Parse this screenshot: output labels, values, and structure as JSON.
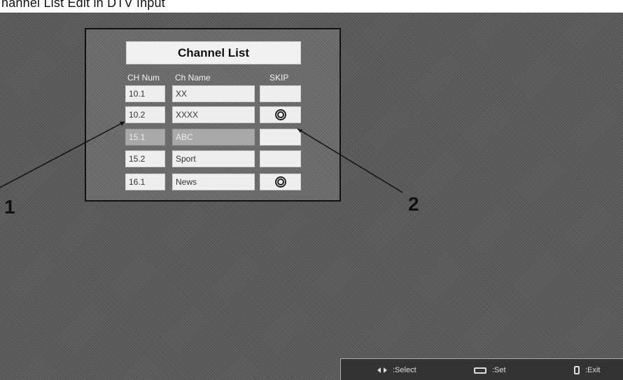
{
  "header": {
    "text": "hannel List Edit in DTV Input"
  },
  "channel_list": {
    "title": "Channel List",
    "columns": {
      "num": "CH Num",
      "name": "Ch  Name",
      "skip": "SKIP"
    },
    "rows": [
      {
        "num": "10.1",
        "name": "XX",
        "skip": false,
        "selected": false
      },
      {
        "num": "10.2",
        "name": "XXXX",
        "skip": true,
        "selected": false
      },
      {
        "num": "15.1",
        "name": "ABC",
        "skip": false,
        "selected": true
      },
      {
        "num": "15.2",
        "name": "Sport",
        "skip": false,
        "selected": false
      },
      {
        "num": "16.1",
        "name": "News",
        "skip": true,
        "selected": false
      }
    ]
  },
  "callouts": {
    "one": "1",
    "two": "2"
  },
  "help_bar": {
    "select": {
      "icon": "left-right-arrow-icon",
      "label": ":Select"
    },
    "set": {
      "icon": "enter-icon",
      "label": ":Set"
    },
    "exit": {
      "icon": "remote-exit-icon",
      "label": ":Exit"
    }
  }
}
